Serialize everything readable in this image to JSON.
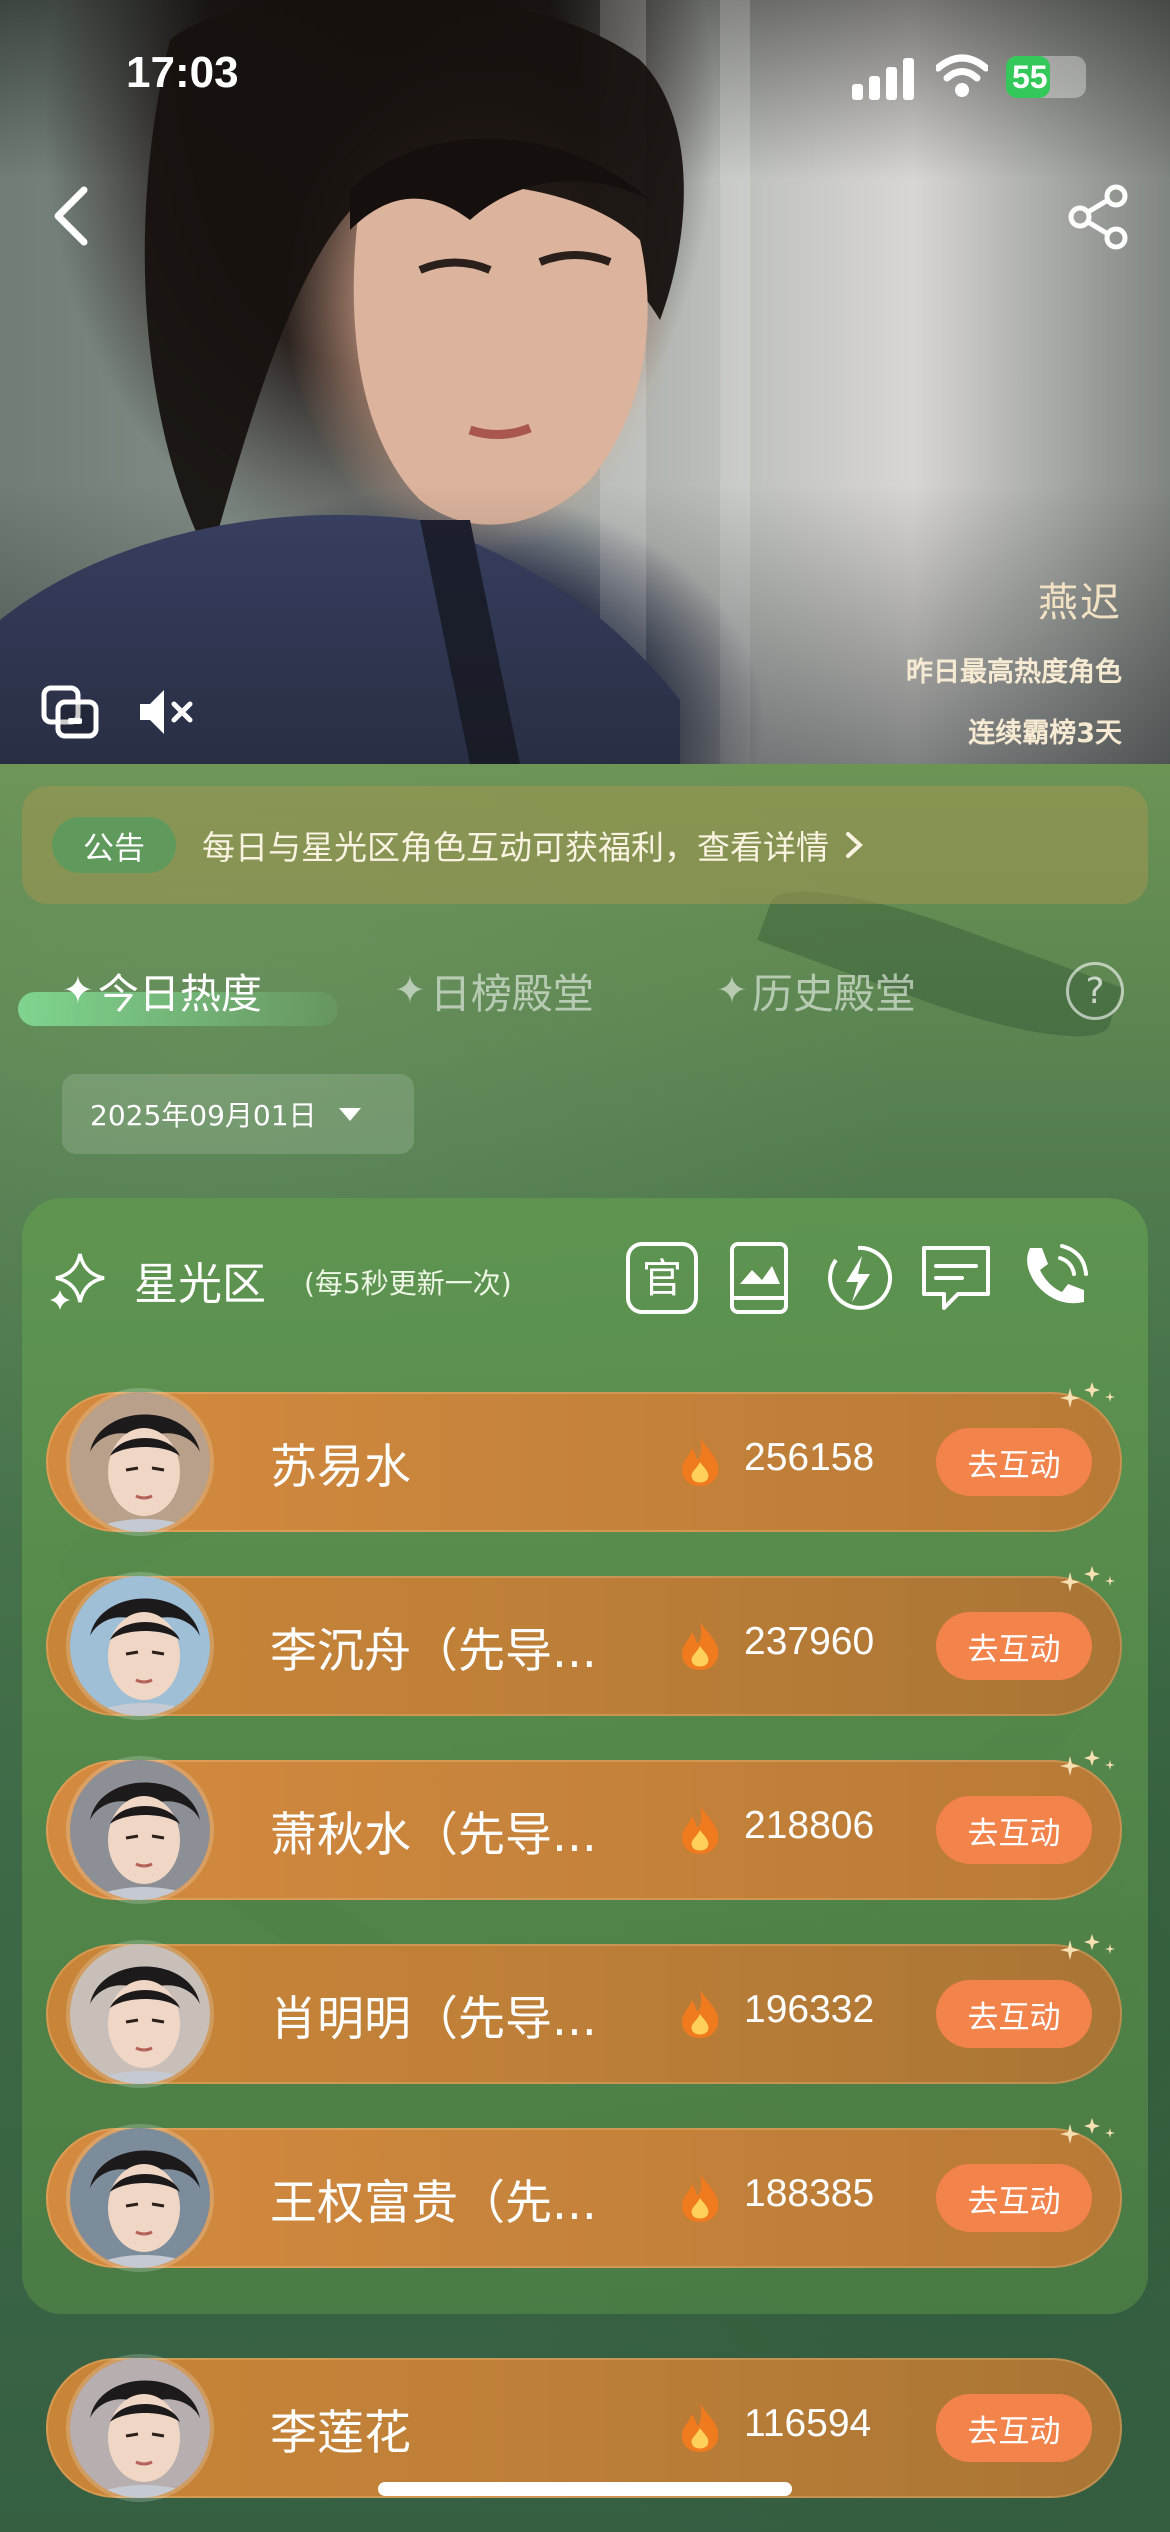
{
  "status_bar": {
    "time": "17:03",
    "battery": "55",
    "battery_level": 0.55
  },
  "hero": {
    "character_name": "燕迟",
    "subtitle": "昨日最高热度角色",
    "streak": "连续霸榜3天"
  },
  "notice": {
    "tag": "公告",
    "text": "每日与星光区角色互动可获福利，查看详情"
  },
  "tabs": [
    {
      "label": "今日热度",
      "active": true
    },
    {
      "label": "日榜殿堂",
      "active": false
    },
    {
      "label": "历史殿堂",
      "active": false
    }
  ],
  "help_label": "?",
  "date_picker": {
    "value": "2025年09月01日"
  },
  "panel": {
    "title": "星光区",
    "note": "(每5秒更新一次)",
    "tools": [
      "official-icon",
      "book-icon",
      "lightning-icon",
      "message-icon",
      "phone-icon"
    ],
    "official_glyph": "官"
  },
  "ranking": [
    {
      "name": "苏易水",
      "score": "256158",
      "action": "去互动",
      "avatar_hue": "#b9a08a"
    },
    {
      "name": "李沉舟（先导...",
      "score": "237960",
      "action": "去互动",
      "avatar_hue": "#9ebfd6"
    },
    {
      "name": "萧秋水（先导...",
      "score": "218806",
      "action": "去互动",
      "avatar_hue": "#8d8f96"
    },
    {
      "name": "肖明明（先导...",
      "score": "196332",
      "action": "去互动",
      "avatar_hue": "#c8c0b8"
    },
    {
      "name": "王权富贵（先...",
      "score": "188385",
      "action": "去互动",
      "avatar_hue": "#7d8c9a"
    },
    {
      "name": "李莲花",
      "score": "116594",
      "action": "去互动",
      "avatar_hue": "#b7aeb0"
    }
  ],
  "colors": {
    "accent_orange": "#f2834b",
    "row_bg": "#c8843c",
    "panel_green": "#5f9651",
    "tag_green": "#5f9a5c"
  }
}
